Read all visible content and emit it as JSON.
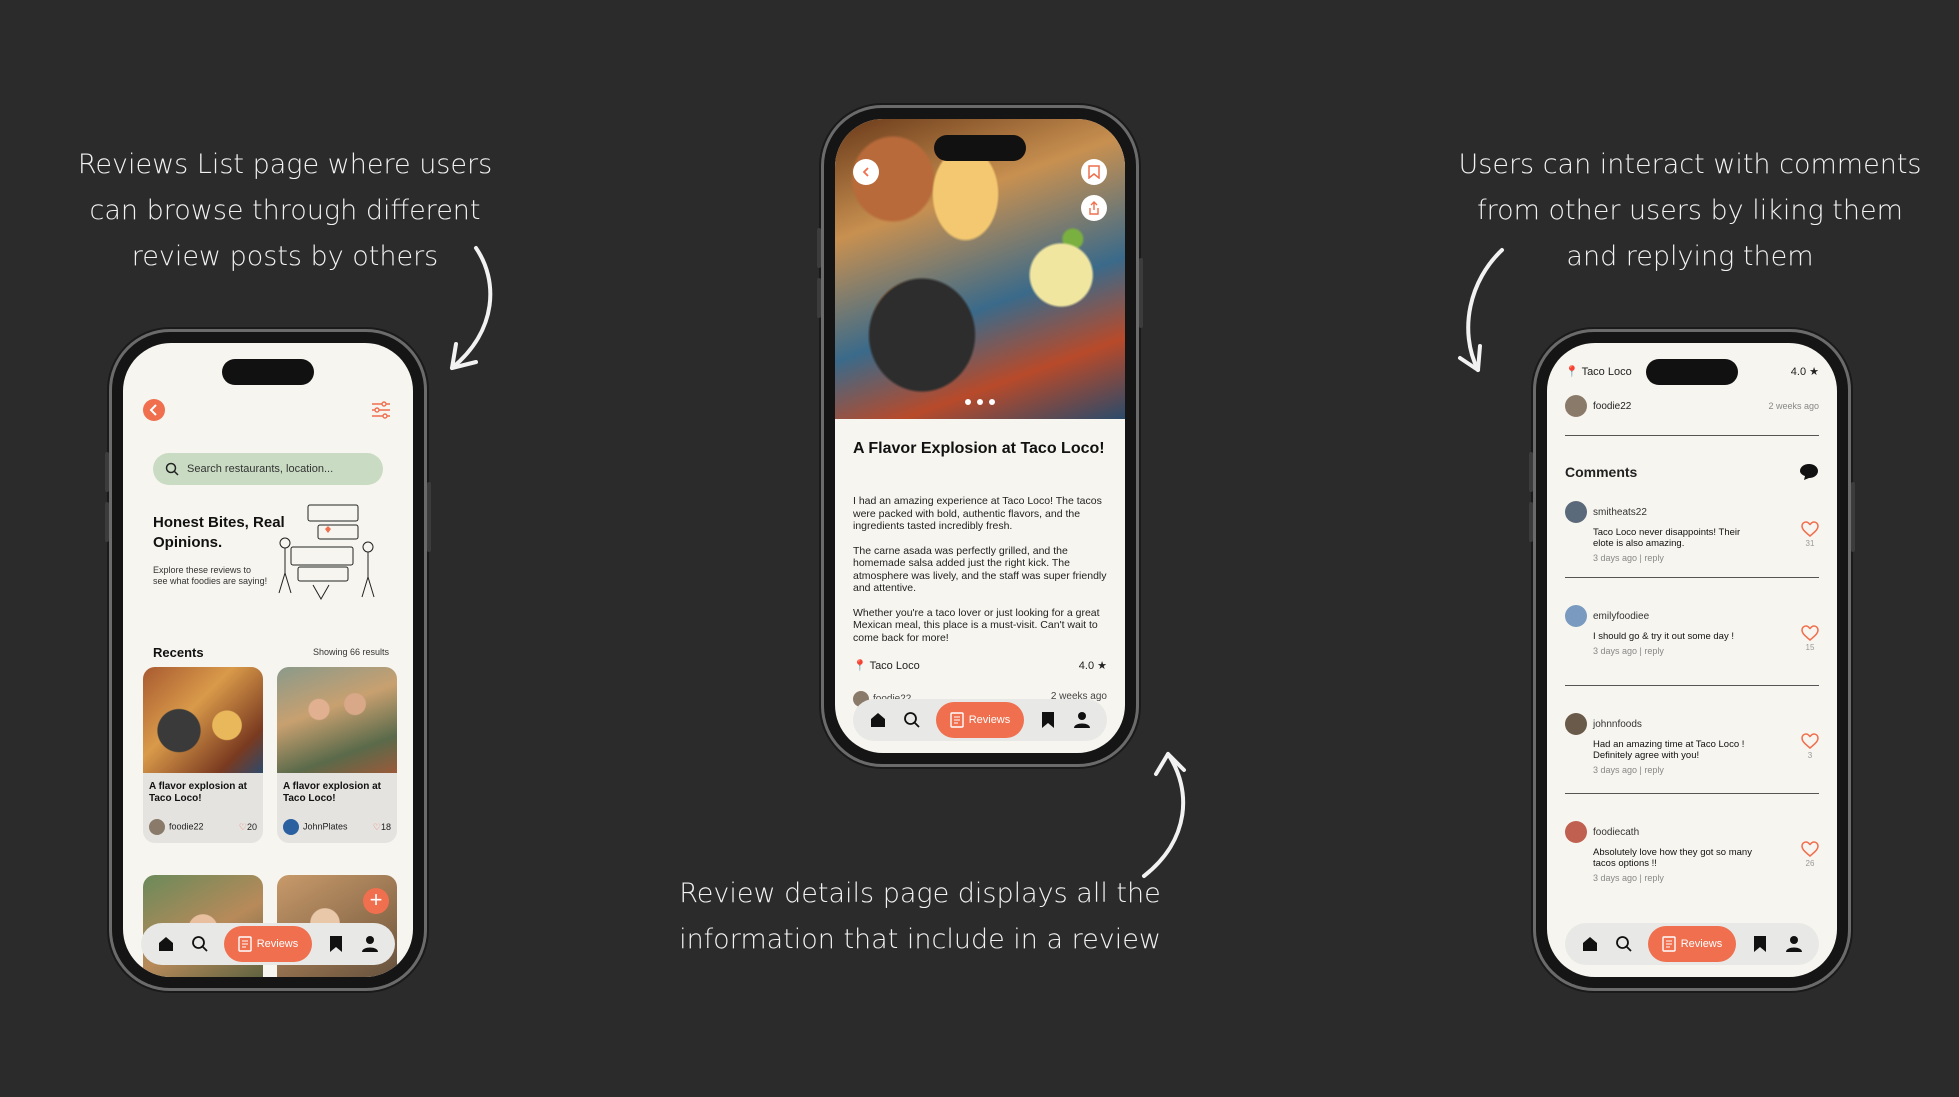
{
  "captions": {
    "left": [
      "Reviews List page where users",
      "can browse through different",
      "review posts by others"
    ],
    "right": [
      "Users can interact with comments",
      "from other users by liking them",
      "and replying them"
    ],
    "bottom": [
      "Review details page displays all the",
      "information that include in a review"
    ]
  },
  "colors": {
    "accent": "#ef6f4e",
    "search_bg": "#c9dcc3",
    "background": "#2b2b2b"
  },
  "nav": {
    "reviews_label": "Reviews"
  },
  "list_page": {
    "search_placeholder": "Search restaurants, location...",
    "hero_title": "Honest Bites, Real Opinions.",
    "hero_subtitle": "Explore these reviews to see what foodies are saying!",
    "recents_label": "Recents",
    "results_label": "Showing 66 results",
    "cards": [
      {
        "title": "A flavor explosion at Taco Loco!",
        "user": "foodie22",
        "likes": "20"
      },
      {
        "title": "A flavor explosion at Taco Loco!",
        "user": "JohnPlates",
        "likes": "18"
      }
    ]
  },
  "detail_page": {
    "title": "A Flavor Explosion at Taco Loco!",
    "paragraphs": [
      "I had an amazing experience at Taco Loco! The tacos were packed with bold, authentic flavors, and the ingredients tasted incredibly fresh.",
      "The carne asada was perfectly grilled, and the homemade salsa added just the right kick. The atmosphere was lively, and the staff was super friendly and attentive.",
      "Whether you're a taco lover or just looking for a great Mexican meal, this place is a must-visit. Can't wait to come back for more!"
    ],
    "location": "Taco Loco",
    "rating": "4.0",
    "user": "foodie22",
    "time": "2 weeks ago"
  },
  "comments_page": {
    "location": "Taco Loco",
    "rating": "4.0",
    "user": "foodie22",
    "time": "2 weeks ago",
    "heading": "Comments",
    "comments": [
      {
        "user": "smitheats22",
        "text": "Taco Loco never disappoints! Their elote is also amazing.",
        "meta": "3 days ago | reply",
        "likes": "31"
      },
      {
        "user": "emilyfoodiee",
        "text": "I should go & try it out some day !",
        "meta": "3 days ago | reply",
        "likes": "15"
      },
      {
        "user": "johnnfoods",
        "text": "Had an amazing time at Taco Loco ! Definitely agree with you!",
        "meta": "3 days ago | reply",
        "likes": "3"
      },
      {
        "user": "foodiecath",
        "text": "Absolutely love how they got so many tacos options !!",
        "meta": "3 days ago | reply",
        "likes": "26"
      }
    ]
  }
}
